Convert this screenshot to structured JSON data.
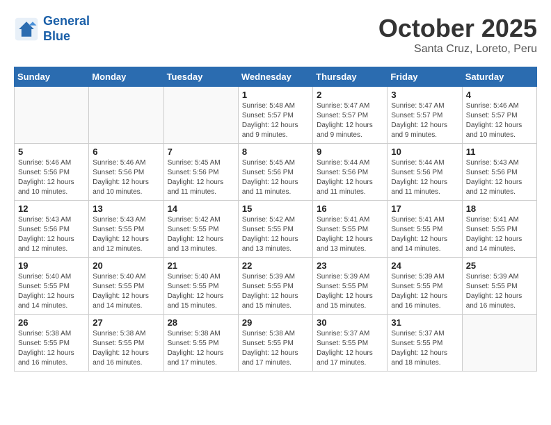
{
  "header": {
    "logo_line1": "General",
    "logo_line2": "Blue",
    "month": "October 2025",
    "location": "Santa Cruz, Loreto, Peru"
  },
  "days_of_week": [
    "Sunday",
    "Monday",
    "Tuesday",
    "Wednesday",
    "Thursday",
    "Friday",
    "Saturday"
  ],
  "weeks": [
    [
      {
        "day": "",
        "info": ""
      },
      {
        "day": "",
        "info": ""
      },
      {
        "day": "",
        "info": ""
      },
      {
        "day": "1",
        "info": "Sunrise: 5:48 AM\nSunset: 5:57 PM\nDaylight: 12 hours and 9 minutes."
      },
      {
        "day": "2",
        "info": "Sunrise: 5:47 AM\nSunset: 5:57 PM\nDaylight: 12 hours and 9 minutes."
      },
      {
        "day": "3",
        "info": "Sunrise: 5:47 AM\nSunset: 5:57 PM\nDaylight: 12 hours and 9 minutes."
      },
      {
        "day": "4",
        "info": "Sunrise: 5:46 AM\nSunset: 5:57 PM\nDaylight: 12 hours and 10 minutes."
      }
    ],
    [
      {
        "day": "5",
        "info": "Sunrise: 5:46 AM\nSunset: 5:56 PM\nDaylight: 12 hours and 10 minutes."
      },
      {
        "day": "6",
        "info": "Sunrise: 5:46 AM\nSunset: 5:56 PM\nDaylight: 12 hours and 10 minutes."
      },
      {
        "day": "7",
        "info": "Sunrise: 5:45 AM\nSunset: 5:56 PM\nDaylight: 12 hours and 11 minutes."
      },
      {
        "day": "8",
        "info": "Sunrise: 5:45 AM\nSunset: 5:56 PM\nDaylight: 12 hours and 11 minutes."
      },
      {
        "day": "9",
        "info": "Sunrise: 5:44 AM\nSunset: 5:56 PM\nDaylight: 12 hours and 11 minutes."
      },
      {
        "day": "10",
        "info": "Sunrise: 5:44 AM\nSunset: 5:56 PM\nDaylight: 12 hours and 11 minutes."
      },
      {
        "day": "11",
        "info": "Sunrise: 5:43 AM\nSunset: 5:56 PM\nDaylight: 12 hours and 12 minutes."
      }
    ],
    [
      {
        "day": "12",
        "info": "Sunrise: 5:43 AM\nSunset: 5:56 PM\nDaylight: 12 hours and 12 minutes."
      },
      {
        "day": "13",
        "info": "Sunrise: 5:43 AM\nSunset: 5:55 PM\nDaylight: 12 hours and 12 minutes."
      },
      {
        "day": "14",
        "info": "Sunrise: 5:42 AM\nSunset: 5:55 PM\nDaylight: 12 hours and 13 minutes."
      },
      {
        "day": "15",
        "info": "Sunrise: 5:42 AM\nSunset: 5:55 PM\nDaylight: 12 hours and 13 minutes."
      },
      {
        "day": "16",
        "info": "Sunrise: 5:41 AM\nSunset: 5:55 PM\nDaylight: 12 hours and 13 minutes."
      },
      {
        "day": "17",
        "info": "Sunrise: 5:41 AM\nSunset: 5:55 PM\nDaylight: 12 hours and 14 minutes."
      },
      {
        "day": "18",
        "info": "Sunrise: 5:41 AM\nSunset: 5:55 PM\nDaylight: 12 hours and 14 minutes."
      }
    ],
    [
      {
        "day": "19",
        "info": "Sunrise: 5:40 AM\nSunset: 5:55 PM\nDaylight: 12 hours and 14 minutes."
      },
      {
        "day": "20",
        "info": "Sunrise: 5:40 AM\nSunset: 5:55 PM\nDaylight: 12 hours and 14 minutes."
      },
      {
        "day": "21",
        "info": "Sunrise: 5:40 AM\nSunset: 5:55 PM\nDaylight: 12 hours and 15 minutes."
      },
      {
        "day": "22",
        "info": "Sunrise: 5:39 AM\nSunset: 5:55 PM\nDaylight: 12 hours and 15 minutes."
      },
      {
        "day": "23",
        "info": "Sunrise: 5:39 AM\nSunset: 5:55 PM\nDaylight: 12 hours and 15 minutes."
      },
      {
        "day": "24",
        "info": "Sunrise: 5:39 AM\nSunset: 5:55 PM\nDaylight: 12 hours and 16 minutes."
      },
      {
        "day": "25",
        "info": "Sunrise: 5:39 AM\nSunset: 5:55 PM\nDaylight: 12 hours and 16 minutes."
      }
    ],
    [
      {
        "day": "26",
        "info": "Sunrise: 5:38 AM\nSunset: 5:55 PM\nDaylight: 12 hours and 16 minutes."
      },
      {
        "day": "27",
        "info": "Sunrise: 5:38 AM\nSunset: 5:55 PM\nDaylight: 12 hours and 16 minutes."
      },
      {
        "day": "28",
        "info": "Sunrise: 5:38 AM\nSunset: 5:55 PM\nDaylight: 12 hours and 17 minutes."
      },
      {
        "day": "29",
        "info": "Sunrise: 5:38 AM\nSunset: 5:55 PM\nDaylight: 12 hours and 17 minutes."
      },
      {
        "day": "30",
        "info": "Sunrise: 5:37 AM\nSunset: 5:55 PM\nDaylight: 12 hours and 17 minutes."
      },
      {
        "day": "31",
        "info": "Sunrise: 5:37 AM\nSunset: 5:55 PM\nDaylight: 12 hours and 18 minutes."
      },
      {
        "day": "",
        "info": ""
      }
    ]
  ]
}
